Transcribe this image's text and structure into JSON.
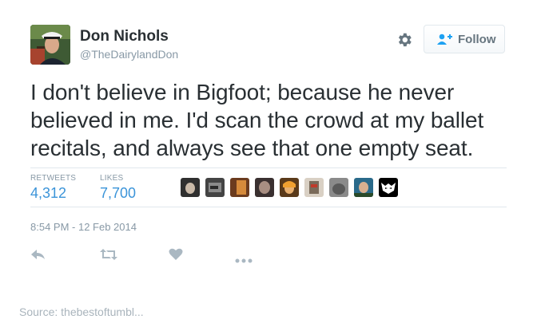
{
  "user": {
    "display_name": "Don Nichols",
    "handle": "@TheDairylandDon"
  },
  "follow_button": {
    "label": "Follow"
  },
  "tweet": {
    "lines": [
      "I don't believe in Bigfoot; because he never",
      "believed in me. I'd scan the crowd at my ballet",
      "recitals, and always see that one empty seat."
    ]
  },
  "stats": {
    "retweets_label": "RETWEETS",
    "retweets_value": "4,312",
    "likes_label": "LIKES",
    "likes_value": "7,700"
  },
  "timestamp": "8:54 PM - 12 Feb 2014",
  "footer": {
    "source": "Source: thebestoftumbl..."
  },
  "icons": {
    "settings": "gear-icon",
    "follow": "add-person-icon",
    "reply": "reply-icon",
    "retweet": "retweet-icon",
    "like": "heart-icon",
    "more": "more-icon"
  },
  "colors": {
    "link_blue": "#3b94d9",
    "muted_gray": "#8899a6",
    "text": "#292f33",
    "icon_gray": "#ccd6dd"
  }
}
